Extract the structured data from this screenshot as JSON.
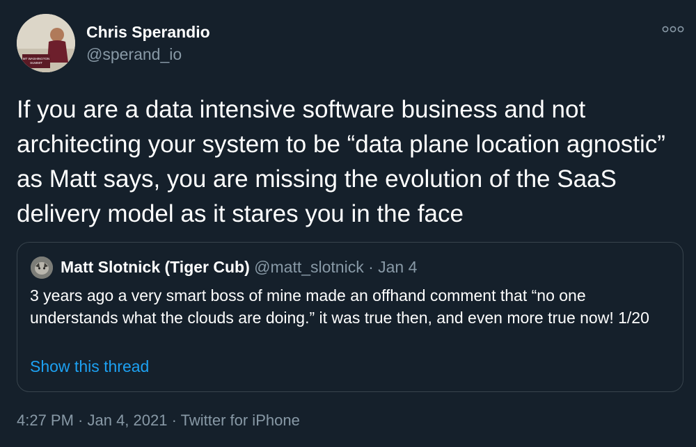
{
  "author": {
    "name": "Chris Sperandio",
    "handle": "@sperand_io",
    "avatar_badge_text": [
      "MT WASHINGTON",
      "SUMMIT"
    ]
  },
  "more_icon": "more-horizontal-icon",
  "tweet": {
    "text": "If you are a data intensive software business and not architecting your system to be “data plane location agnostic” as Matt says, you are missing the evolution of the SaaS delivery model as it stares you in the face"
  },
  "quoted_tweet": {
    "author_name": "Matt Slotnick (Tiger Cub)",
    "handle_and_date": "@matt_slotnick · Jan 4",
    "text": "3 years ago a very smart boss of mine made an offhand comment that “no one understands what the clouds are doing.” it was true then, and even more true now! 1/20",
    "show_thread_label": "Show this thread"
  },
  "meta": {
    "text": "4:27 PM · Jan 4, 2021 · Twitter for iPhone"
  },
  "colors": {
    "background": "#15202b",
    "text_primary": "#ffffff",
    "text_secondary": "#8899a6",
    "link": "#1da1f2",
    "border": "#38444d"
  }
}
